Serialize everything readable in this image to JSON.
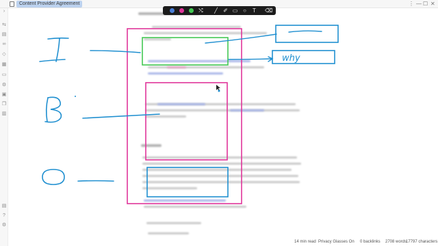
{
  "window": {
    "title": "Content Provider Agreement",
    "controls": {
      "more": "⋮",
      "minimize": "—",
      "maximize": "☐",
      "close": "✕"
    }
  },
  "sidebar": {
    "items": [
      {
        "icon": "chevron-right-icon",
        "glyph": "›"
      },
      {
        "icon": "toggle-icon",
        "glyph": "⇆"
      },
      {
        "icon": "folder-icon",
        "glyph": "▤"
      },
      {
        "icon": "graph-icon",
        "glyph": "∞"
      },
      {
        "icon": "tag-icon",
        "glyph": "◇"
      },
      {
        "icon": "calendar-icon",
        "glyph": "▦"
      },
      {
        "icon": "file-icon",
        "glyph": "▭"
      },
      {
        "icon": "plugin-icon",
        "glyph": "⚙"
      },
      {
        "icon": "terminal-icon",
        "glyph": "▣"
      },
      {
        "icon": "copy-icon",
        "glyph": "❐"
      },
      {
        "icon": "archive-icon",
        "glyph": "▥"
      }
    ],
    "bottom": [
      {
        "icon": "vault-icon",
        "glyph": "▤"
      },
      {
        "icon": "help-icon",
        "glyph": "?"
      },
      {
        "icon": "settings-icon",
        "glyph": "⚙"
      }
    ]
  },
  "toolbar": {
    "colors": [
      "#4a7fd8",
      "#e0359a",
      "#43c853"
    ],
    "tools": [
      {
        "name": "shuffle-icon",
        "glyph": "⤭"
      },
      {
        "name": "pen-icon",
        "glyph": "╱"
      },
      {
        "name": "highlighter-icon",
        "glyph": "✐"
      },
      {
        "name": "rectangle-icon",
        "glyph": "▭"
      },
      {
        "name": "circle-icon",
        "glyph": "○"
      },
      {
        "name": "text-icon",
        "glyph": "T"
      },
      {
        "name": "eraser-icon",
        "glyph": "⌫"
      }
    ]
  },
  "ink": {
    "magenta": "#e0359a",
    "green": "#43c853",
    "blue": "#1f8fd0",
    "handwriting": {
      "letter_1": "I",
      "letter_2": "B",
      "letter_3": "O",
      "box_note": "why"
    }
  },
  "status": {
    "read_time": "14 min read",
    "privacy": "Privacy Glasses On",
    "backlinks": "0 backlinks",
    "words": "2708 words",
    "characters": "17797 characters"
  }
}
